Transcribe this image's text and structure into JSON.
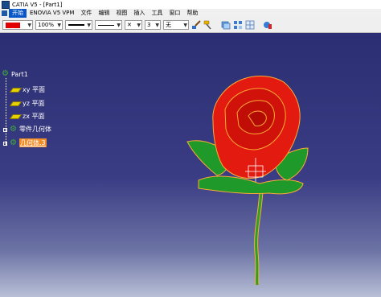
{
  "window": {
    "title": "CATIA V5 - [Part1]"
  },
  "menu": {
    "items": [
      {
        "label": "开始",
        "active": true
      },
      {
        "label": "ENOVIA V5 VPM",
        "active": false
      },
      {
        "label": "文件",
        "active": false
      },
      {
        "label": "编辑",
        "active": false
      },
      {
        "label": "视图",
        "active": false
      },
      {
        "label": "插入",
        "active": false
      },
      {
        "label": "工具",
        "active": false
      },
      {
        "label": "窗口",
        "active": false
      },
      {
        "label": "帮助",
        "active": false
      }
    ]
  },
  "toolbar": {
    "color": "#e30000",
    "transparency": "100%",
    "line_thickness_icon": "line-thickness",
    "line_type_icon": "line-type",
    "point_symbol": "✕",
    "layer": "3",
    "rendering_style": "无",
    "icons": [
      "paint-brush-icon",
      "format-painter-icon",
      "layer-icon",
      "properties-icon",
      "apply-material-icon"
    ]
  },
  "tree": {
    "root": "Part1",
    "items": [
      {
        "label": "xy 平面",
        "icon": "plane-icon"
      },
      {
        "label": "yz 平面",
        "icon": "plane-icon"
      },
      {
        "label": "zx 平面",
        "icon": "plane-icon"
      },
      {
        "label": "零件几何体",
        "icon": "body-icon"
      },
      {
        "label": "几何体.3",
        "icon": "body-icon",
        "selected": true
      }
    ]
  },
  "colors": {
    "petal": "#e21a10",
    "petal_edge": "#ffaa33",
    "leaf": "#1f9a2a",
    "stem": "#2c9f2c",
    "selection": "#f28c28"
  }
}
